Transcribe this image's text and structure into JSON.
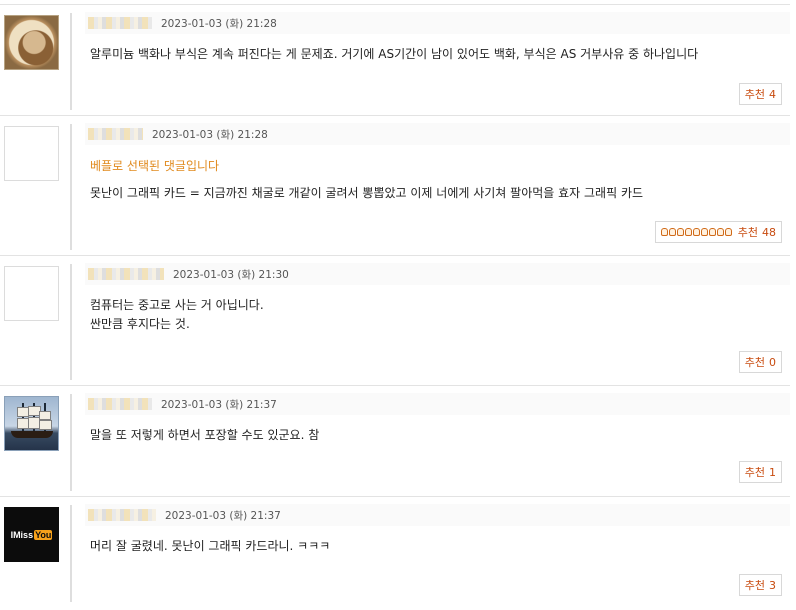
{
  "comments": [
    {
      "avatar_icon": "portrait-avatar-icon",
      "date": "2023-01-03 (화) 21:28",
      "best_label": "",
      "lines": [
        "알루미늄 백화나 부식은 계속 퍼진다는 게 문제죠. 거기에 AS기간이 남이 있어도 백화, 부식은 AS 거부사유 중 하나입니다"
      ],
      "rec_label": "추천",
      "rec_count": "4",
      "thumbs": 0
    },
    {
      "avatar_icon": "empty-avatar-icon",
      "date": "2023-01-03 (화) 21:28",
      "best_label": "베플로 선택된 댓글입니다",
      "lines": [
        "못난이 그래픽 카드 = 지금까진 채굴로 개같이 굴려서 뽕뽑았고 이제 너에게 사기쳐 팔아먹을 효자 그래픽 카드"
      ],
      "rec_label": "추천",
      "rec_count": "48",
      "thumbs": 9
    },
    {
      "avatar_icon": "empty-avatar-icon",
      "date": "2023-01-03 (화) 21:30",
      "best_label": "",
      "lines": [
        "컴퓨터는 중고로 사는 거 아닙니다.",
        "싼만큼 후지다는 것."
      ],
      "rec_label": "추천",
      "rec_count": "0",
      "thumbs": 0
    },
    {
      "avatar_icon": "ship-avatar-icon",
      "date": "2023-01-03 (화) 21:37",
      "best_label": "",
      "lines": [
        "말을 또 저렇게 하면서 포장할 수도 있군요. 참"
      ],
      "rec_label": "추천",
      "rec_count": "1",
      "thumbs": 0
    },
    {
      "avatar_icon": "brand-avatar-icon",
      "avatar_text": "IMiss",
      "avatar_text_highlight": "You",
      "date": "2023-01-03 (화) 21:37",
      "best_label": "",
      "lines": [
        "머리 잘 굴렸네. 못난이 그래픽 카드라니. ㅋㅋㅋ"
      ],
      "rec_label": "추천",
      "rec_count": "3",
      "thumbs": 0
    }
  ],
  "colors": {
    "best_label": "#e08a1e",
    "recommend_text": "#c84b0f",
    "meta_background": "#fafafa"
  }
}
